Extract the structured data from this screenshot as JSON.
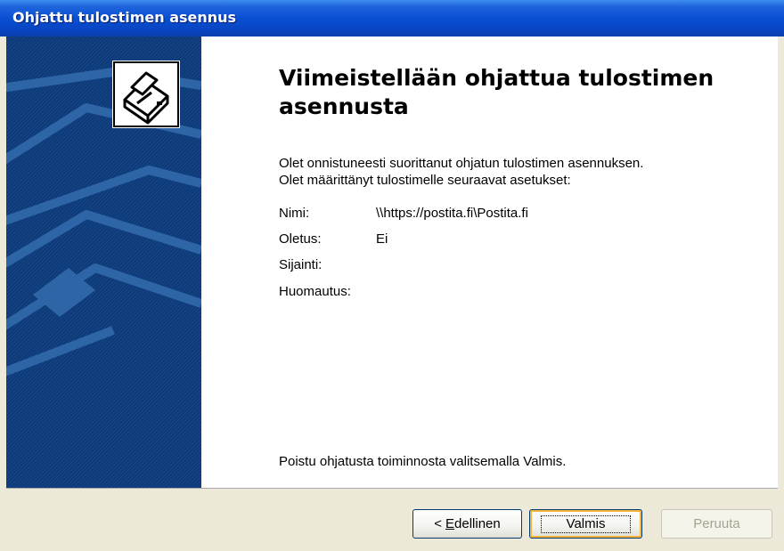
{
  "window": {
    "title": "Ohjattu tulostimen asennus"
  },
  "heading": "Viimeistellään ohjattua tulostimen asennusta",
  "intro": {
    "line1": "Olet onnistuneesti suorittanut ohjatun tulostimen asennuksen.",
    "line2": "Olet määrittänyt tulostimelle seuraavat asetukset:"
  },
  "settings": [
    {
      "label": "Nimi:",
      "value": "\\\\https://postita.fi\\Postita.fi"
    },
    {
      "label": "Oletus:",
      "value": "Ei"
    },
    {
      "label": "Sijainti:",
      "value": ""
    },
    {
      "label": "Huomautus:",
      "value": ""
    }
  ],
  "finish_note": "Poistu ohjatusta toiminnosta valitsemalla Valmis.",
  "buttons": {
    "back_arrow": "<",
    "back_mnemonic": "E",
    "back_rest": "dellinen",
    "finish": "Valmis",
    "cancel": "Peruuta"
  },
  "colors": {
    "titlebar": "#0a4fd3",
    "side_panel": "#0d3a78",
    "dialog_face": "#ece9d8",
    "default_button_highlight": "#f8b33a"
  },
  "icons": {
    "header": "printer-icon"
  }
}
